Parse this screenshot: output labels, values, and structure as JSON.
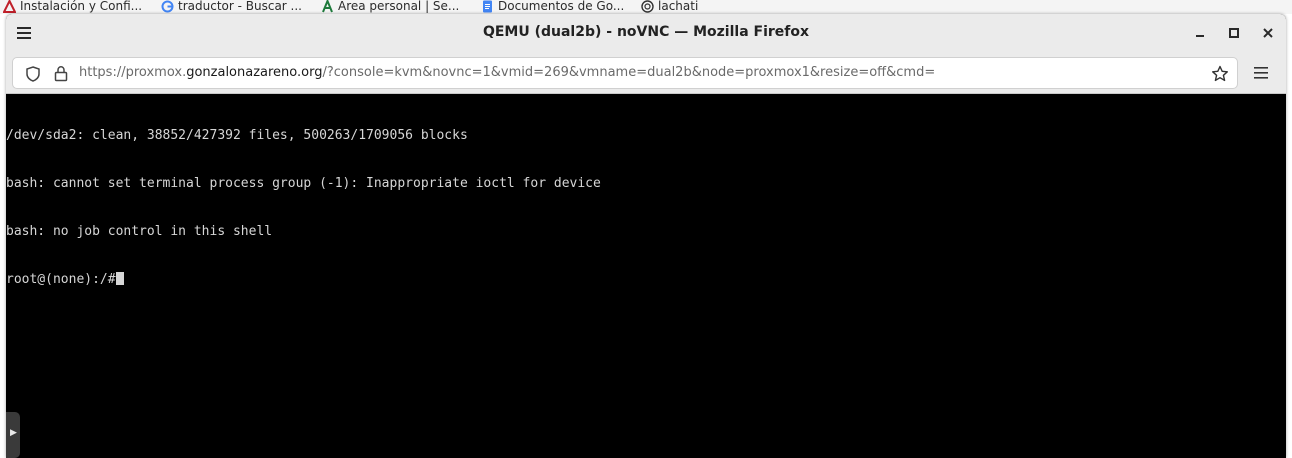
{
  "bookmarks": [
    {
      "label": "Instalación y Confi...",
      "icon": "red-triangle-icon"
    },
    {
      "label": "traductor - Buscar ...",
      "icon": "google-icon"
    },
    {
      "label": "Área personal | Se...",
      "icon": "green-a-icon"
    },
    {
      "label": "Documentos de Go...",
      "icon": "google-docs-icon"
    },
    {
      "label": "lachati",
      "icon": "openai-icon"
    }
  ],
  "window": {
    "title": "QEMU (dual2b) - noVNC — Mozilla Firefox"
  },
  "urlbar": {
    "url_prefix": "https://proxmox.",
    "url_domain": "gonzalonazareno.org",
    "url_suffix": "/?console=kvm&novnc=1&vmid=269&vmname=dual2b&node=proxmox1&resize=off&cmd="
  },
  "terminal": {
    "lines": [
      "/dev/sda2: clean, 38852/427392 files, 500263/1709056 blocks",
      "bash: cannot set terminal process group (-1): Inappropriate ioctl for device",
      "bash: no job control in this shell",
      "root@(none):/#"
    ]
  },
  "novnc": {
    "handle_glyph": "▶"
  },
  "colors": {
    "titlebar_bg": "#ebebeb",
    "console_bg": "#000000",
    "terminal_text": "#d6d6d6"
  }
}
